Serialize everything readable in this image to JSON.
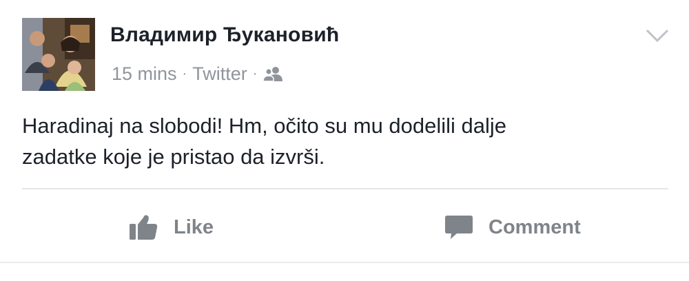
{
  "post": {
    "author": "Владимир Ђукановић",
    "timestamp": "15 mins",
    "separator": "·",
    "source": "Twitter",
    "audience_icon": "friends-icon",
    "menu_icon": "chevron-down-icon",
    "message_line_1": "Haradinaj na slobodi! Hm, očito su mu dodelili dalje",
    "message_line_2": "zadatke koje je pristao da izvrši."
  },
  "actions": {
    "like": {
      "label": "Like",
      "icon": "thumbs-up-icon"
    },
    "comment": {
      "label": "Comment",
      "icon": "comment-bubble-icon"
    }
  },
  "colors": {
    "text": "#1d2129",
    "meta": "#90949c",
    "action": "#7f838a",
    "divider": "#e5e6e9"
  }
}
